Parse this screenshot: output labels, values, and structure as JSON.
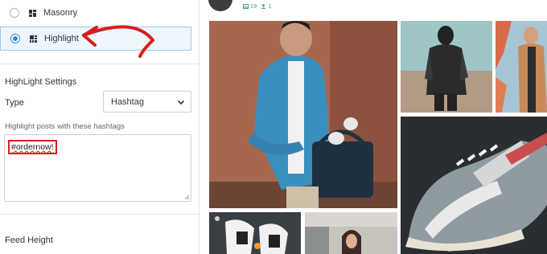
{
  "layout_options": [
    {
      "label": "Masonry",
      "selected": false,
      "icon": "masonry-grid-icon"
    },
    {
      "label": "Highlight",
      "selected": true,
      "icon": "highlight-grid-icon"
    }
  ],
  "highlight_settings": {
    "title": "HighLight Settings",
    "type_label": "Type",
    "type_value": "Hashtag",
    "hashtags_label": "Highlight posts with these hashtags",
    "hashtags_value": "#ordernow!"
  },
  "feed_height": {
    "title": "Feed Height"
  },
  "preview": {
    "stats": {
      "posts": "19",
      "followers": "1"
    },
    "colors": {
      "accent": "#2a8bd6",
      "annotation_red": "#d81e1e",
      "stat_green": "#4aa37a"
    }
  }
}
